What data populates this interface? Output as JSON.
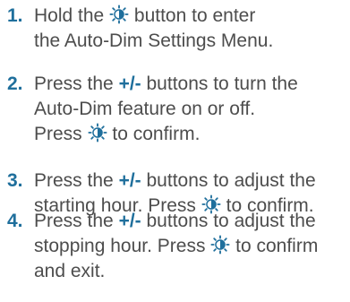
{
  "steps": [
    {
      "number": "1.",
      "line1_pre": "Hold the",
      "line1_post": "button to enter",
      "line2": "the Auto-Dim Settings Menu."
    },
    {
      "number": "2.",
      "line1_pre": "Press the",
      "line1_bold": "+/-",
      "line1_post": "buttons to turn the",
      "line2": "Auto-Dim feature on or off.",
      "line3_pre": "Press",
      "line3_post": "to confirm."
    },
    {
      "number": "3.",
      "line1_pre": "Press the",
      "line1_bold": "+/-",
      "line1_post": "buttons to adjust the",
      "line2_pre": "starting hour. Press",
      "line2_post": "to confirm."
    },
    {
      "number": "4.",
      "line1_pre": "Press the",
      "line1_bold": "+/-",
      "line1_post": "buttons to adjust the",
      "line2_pre": "stopping hour. Press",
      "line2_post": "to confirm",
      "line3": "and exit."
    }
  ],
  "icons": {
    "dim_button": "dim-button-icon"
  },
  "colors": {
    "accent": "#1f6f9c",
    "text": "#4d4d4d"
  }
}
